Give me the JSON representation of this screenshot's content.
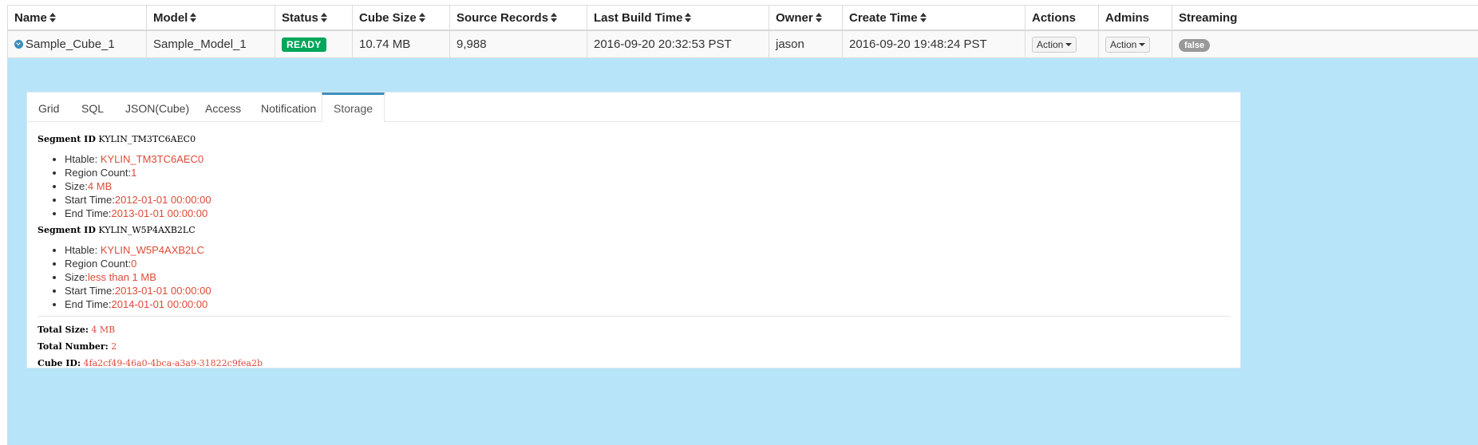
{
  "columns": [
    {
      "label": "Name",
      "sortable": true
    },
    {
      "label": "Model",
      "sortable": true
    },
    {
      "label": "Status",
      "sortable": true
    },
    {
      "label": "Cube Size",
      "sortable": true
    },
    {
      "label": "Source Records",
      "sortable": true
    },
    {
      "label": "Last Build Time",
      "sortable": true
    },
    {
      "label": "Owner",
      "sortable": true
    },
    {
      "label": "Create Time",
      "sortable": true
    },
    {
      "label": "Actions",
      "sortable": false
    },
    {
      "label": "Admins",
      "sortable": false
    },
    {
      "label": "Streaming",
      "sortable": false
    }
  ],
  "row": {
    "name": "Sample_Cube_1",
    "model": "Sample_Model_1",
    "status": "READY",
    "cube_size": "10.74 MB",
    "source_records": "9,988",
    "last_build_time": "2016-09-20 20:32:53 PST",
    "owner": "jason",
    "create_time": "2016-09-20 19:48:24 PST",
    "actions_label": "Action",
    "admins_label": "Action",
    "streaming": "false"
  },
  "tabs": [
    "Grid",
    "SQL",
    "JSON(Cube)",
    "Access",
    "Notification",
    "Storage"
  ],
  "active_tab": "Storage",
  "storage": {
    "segment_label": "Segment ID",
    "htable_label": "Htable:",
    "region_label": "Region Count:",
    "size_label": "Size:",
    "start_label": "Start Time:",
    "end_label": "End Time:",
    "segments": [
      {
        "id": "KYLIN_TM3TC6AEC0",
        "htable": "KYLIN_TM3TC6AEC0",
        "region_count": "1",
        "size": "4 MB",
        "start_time": "2012-01-01 00:00:00",
        "end_time": "2013-01-01 00:00:00"
      },
      {
        "id": "KYLIN_W5P4AXB2LC",
        "htable": "KYLIN_W5P4AXB2LC",
        "region_count": "0",
        "size": "less than 1 MB",
        "start_time": "2013-01-01 00:00:00",
        "end_time": "2014-01-01 00:00:00"
      }
    ],
    "total_size_label": "Total Size:",
    "total_size": "4 MB",
    "total_number_label": "Total Number:",
    "total_number": "2",
    "cube_id_label": "Cube ID:",
    "cube_id": "4fa2cf49-46a0-4bca-a3a9-31822c9fea2b"
  },
  "colors": {
    "status_ready": "#00a65a",
    "value_red": "#dd4b39",
    "detail_bg": "#b8e4fa",
    "tab_active_border": "#3c8dbc"
  }
}
